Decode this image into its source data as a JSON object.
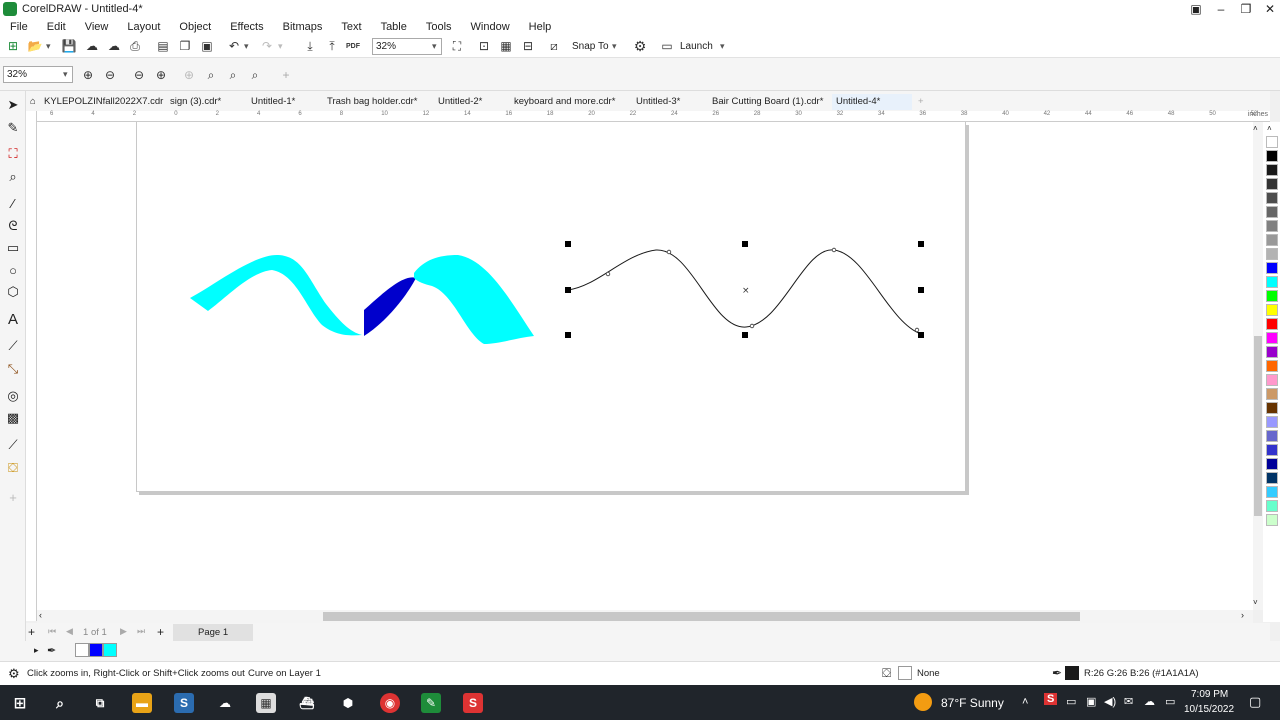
{
  "window": {
    "title": "CorelDRAW - Untitled-4*"
  },
  "menu": [
    "File",
    "Edit",
    "View",
    "Layout",
    "Object",
    "Effects",
    "Bitmaps",
    "Text",
    "Table",
    "Tools",
    "Window",
    "Help"
  ],
  "toolbar": {
    "zoom_value": "32%",
    "snap_label": "Snap To",
    "launch_label": "Launch",
    "pdf_label": "PDF"
  },
  "property_bar": {
    "zoom_value": "32%"
  },
  "tabs": [
    {
      "label": "KYLEPOLZINfall2022X7.cdr"
    },
    {
      "label": "sign (3).cdr*"
    },
    {
      "label": "Untitled-1*"
    },
    {
      "label": "Trash bag holder.cdr*"
    },
    {
      "label": "Untitled-2*"
    },
    {
      "label": "keyboard and more.cdr*"
    },
    {
      "label": "Untitled-3*"
    },
    {
      "label": "Bair Cutting Board (1).cdr*"
    },
    {
      "label": "Untitled-4*"
    }
  ],
  "ruler": {
    "unit": "inches",
    "ticks": [
      "6",
      "4",
      "2",
      "0",
      "2",
      "4",
      "6",
      "8",
      "10",
      "12",
      "14",
      "16",
      "18",
      "20",
      "22",
      "24",
      "26",
      "28",
      "30",
      "32",
      "34",
      "36",
      "38",
      "40",
      "42",
      "44",
      "46",
      "48",
      "50",
      "52"
    ]
  },
  "page_nav": {
    "position": "1",
    "of_label": "of",
    "total": "1",
    "page_tab": "Page 1"
  },
  "status": {
    "hint": "Click zooms in, Right-Click or Shift+Click zooms out",
    "object_info": "Curve on Layer 1",
    "fill_label": "None",
    "outline_color": "R:26 G:26 B:26 (#1A1A1A)"
  },
  "taskbar": {
    "weather": "87°F  Sunny",
    "time": "7:09 PM",
    "date": "10/15/2022"
  },
  "colors": {
    "ribbon_fill": "#00ffff",
    "ribbon_back": "#0000cc",
    "accent_green": "#1e8c3a"
  },
  "palette": [
    "#ffffff",
    "#000000",
    "#1a1a1a",
    "#333333",
    "#4d4d4d",
    "#666666",
    "#808080",
    "#999999",
    "#b3b3b3",
    "#0000ff",
    "#00ffff",
    "#00ff00",
    "#ffff00",
    "#ff0000",
    "#ff00ff",
    "#9900cc",
    "#ff6600",
    "#ff99cc",
    "#cc9966",
    "#663300",
    "#9999ff",
    "#6666cc",
    "#3333cc",
    "#000099",
    "#003366",
    "#33ccff",
    "#66ffcc",
    "#ccffcc"
  ]
}
